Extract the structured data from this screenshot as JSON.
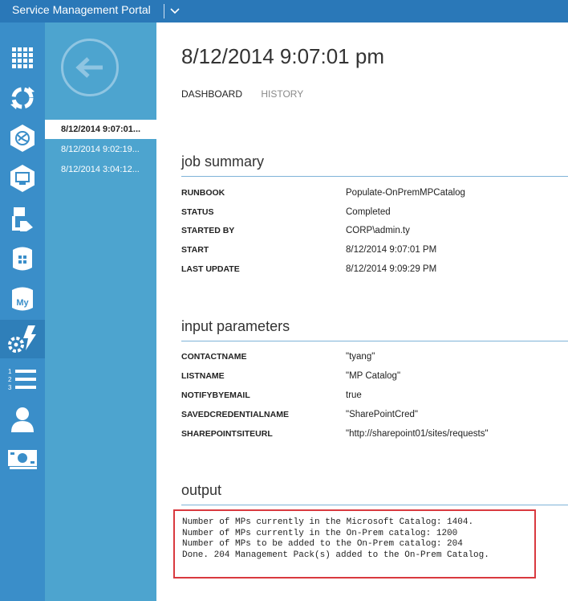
{
  "app": {
    "title": "Service Management Portal"
  },
  "rail": {
    "items": [
      {
        "icon": "all-items-grid-icon"
      },
      {
        "icon": "automation-cycle-icon"
      },
      {
        "icon": "websites-icon"
      },
      {
        "icon": "virtual-machines-icon"
      },
      {
        "icon": "service-bus-icon"
      },
      {
        "icon": "sql-database-icon"
      },
      {
        "icon": "mysql-database-icon"
      },
      {
        "icon": "automation-runbooks-icon",
        "active": true
      },
      {
        "icon": "plans-list-icon"
      },
      {
        "icon": "user-accounts-icon"
      },
      {
        "icon": "subscriptions-icon"
      }
    ]
  },
  "jobs_list": {
    "items": [
      {
        "label": "8/12/2014 9:07:01...",
        "selected": true
      },
      {
        "label": "8/12/2014 9:02:19..."
      },
      {
        "label": "8/12/2014 3:04:12..."
      }
    ]
  },
  "main": {
    "title": "8/12/2014 9:07:01 pm",
    "tabs": [
      {
        "label": "DASHBOARD",
        "active": true
      },
      {
        "label": "HISTORY"
      }
    ],
    "job_summary": {
      "heading": "job summary",
      "rows": [
        {
          "key": "RUNBOOK",
          "value": "Populate-OnPremMPCatalog"
        },
        {
          "key": "STATUS",
          "value": "Completed"
        },
        {
          "key": "STARTED BY",
          "value": "CORP\\admin.ty"
        },
        {
          "key": "START",
          "value": "8/12/2014 9:07:01 PM"
        },
        {
          "key": "LAST UPDATE",
          "value": "8/12/2014 9:09:29 PM"
        }
      ]
    },
    "input_parameters": {
      "heading": "input parameters",
      "rows": [
        {
          "key": "CONTACTNAME",
          "value": "\"tyang\""
        },
        {
          "key": "LISTNAME",
          "value": "\"MP Catalog\""
        },
        {
          "key": "NOTIFYBYEMAIL",
          "value": "true"
        },
        {
          "key": "SAVEDCREDENTIALNAME",
          "value": "\"SharePointCred\""
        },
        {
          "key": "SHAREPOINTSITEURL",
          "value": "\"http://sharepoint01/sites/requests\""
        }
      ]
    },
    "output": {
      "heading": "output",
      "lines": [
        "Number of MPs currently in the Microsoft Catalog: 1404.",
        "Number of MPs currently in the On-Prem catalog: 1200",
        "Number of MPs to be added to the On-Prem catalog: 204",
        "Done. 204 Management Pack(s) added to the On-Prem Catalog."
      ]
    }
  },
  "colors": {
    "topbar": "#2a78b8",
    "rail": "#3a8ec9",
    "panel": "#4da4cf",
    "accent_rule": "#7fb3d8",
    "highlight_border": "#d9393f"
  }
}
